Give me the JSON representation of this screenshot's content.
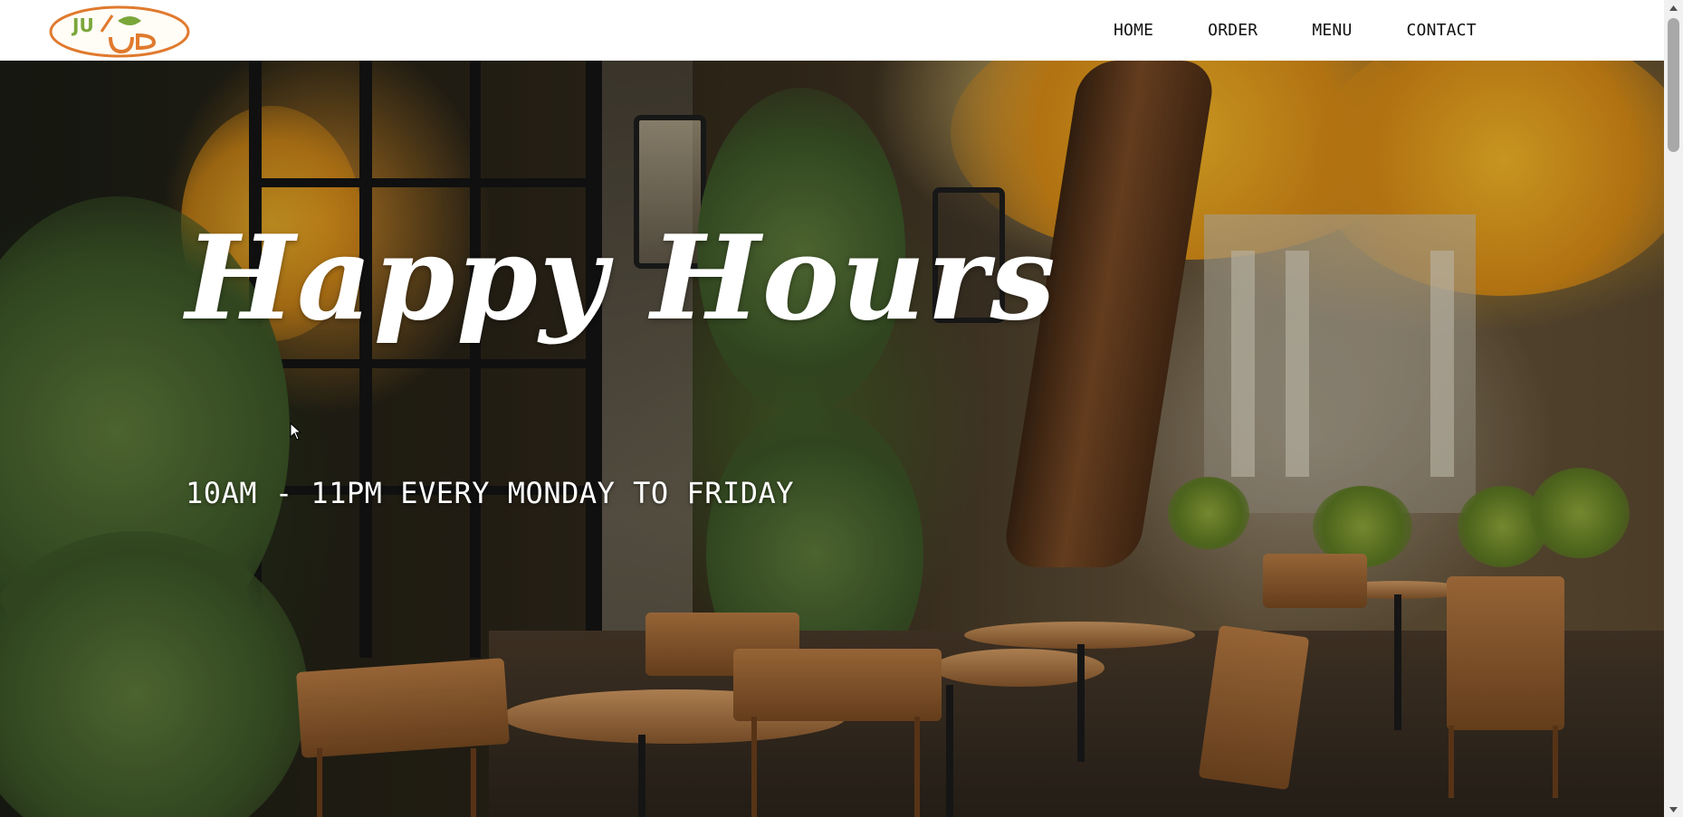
{
  "nav": {
    "items": [
      {
        "label": "HOME"
      },
      {
        "label": "ORDER"
      },
      {
        "label": "MENU"
      },
      {
        "label": "CONTACT"
      }
    ]
  },
  "logo": {
    "icon": "juice-up-logo",
    "text": "JUICE UP"
  },
  "hero": {
    "title": "Happy Hours",
    "subtitle": "10AM - 11PM EVERY MONDAY TO FRIDAY",
    "image": "autumn-cafe-terrace-photo"
  },
  "colors": {
    "header_bg": "#ffffff",
    "nav_text": "#111111",
    "hero_text": "#ffffff",
    "logo_orange": "#e07a2e",
    "logo_green": "#7aa63a"
  }
}
